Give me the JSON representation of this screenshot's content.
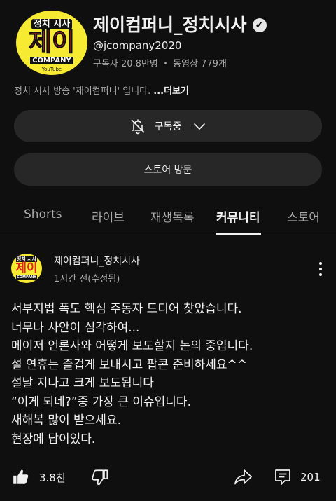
{
  "channel": {
    "avatar_logo": {
      "top": "정치 시사",
      "main": "제이",
      "company": "COMPANY",
      "badge": "YouTube"
    },
    "title": "제이컴퍼니_정치시사",
    "verified_glyph": "✔",
    "handle": "@jcompany2020",
    "stats": "구독자 20.8만명 ・ 동영상 779개",
    "description": "정치 시사 방송  '제이컴퍼니' 입니다.",
    "more_label": "...더보기"
  },
  "buttons": {
    "subscribed_label": "구독중",
    "store_label": "스토어 방문"
  },
  "tabs": [
    {
      "label": "Shorts",
      "active": false
    },
    {
      "label": "라이브",
      "active": false
    },
    {
      "label": "재생목록",
      "active": false
    },
    {
      "label": "커뮤니티",
      "active": true
    },
    {
      "label": "스토어",
      "active": false
    }
  ],
  "post": {
    "author": "제이컴퍼니_정치시사",
    "time": "1시간 전(수정됨)",
    "lines": [
      "서부지법 폭도 핵심 주동자 드디어 찾았습니다.",
      "너무나 사안이 심각하여...",
      "메이저 언론사와 어떻게 보도할지 논의 중입니다.",
      "설 연휴는 즐겁게 보내시고 팝콘 준비하세요^^",
      "설날 지나고 크게 보도됩니다",
      "“이게 되네?”중 가장 큰 이슈입니다.",
      "새해복 많이 받으세요.",
      "현장에 답이있다."
    ],
    "likes": "3.8천",
    "comments": "201"
  },
  "icons": {
    "bell_off": "bell-off-icon",
    "chevron": "chevron-down-icon",
    "verified": "verified-check-icon",
    "more": "more-vert-icon",
    "like": "thumbs-up-icon",
    "dislike": "thumbs-down-icon",
    "share": "share-icon",
    "comment": "comment-icon"
  },
  "colors": {
    "background": "#0f0f0f",
    "button_bg": "#272727",
    "text": "#f1f1f1",
    "secondary_text": "#aaaaaa",
    "logo_yellow": "#f6ea33",
    "logo_red": "#e52222"
  }
}
